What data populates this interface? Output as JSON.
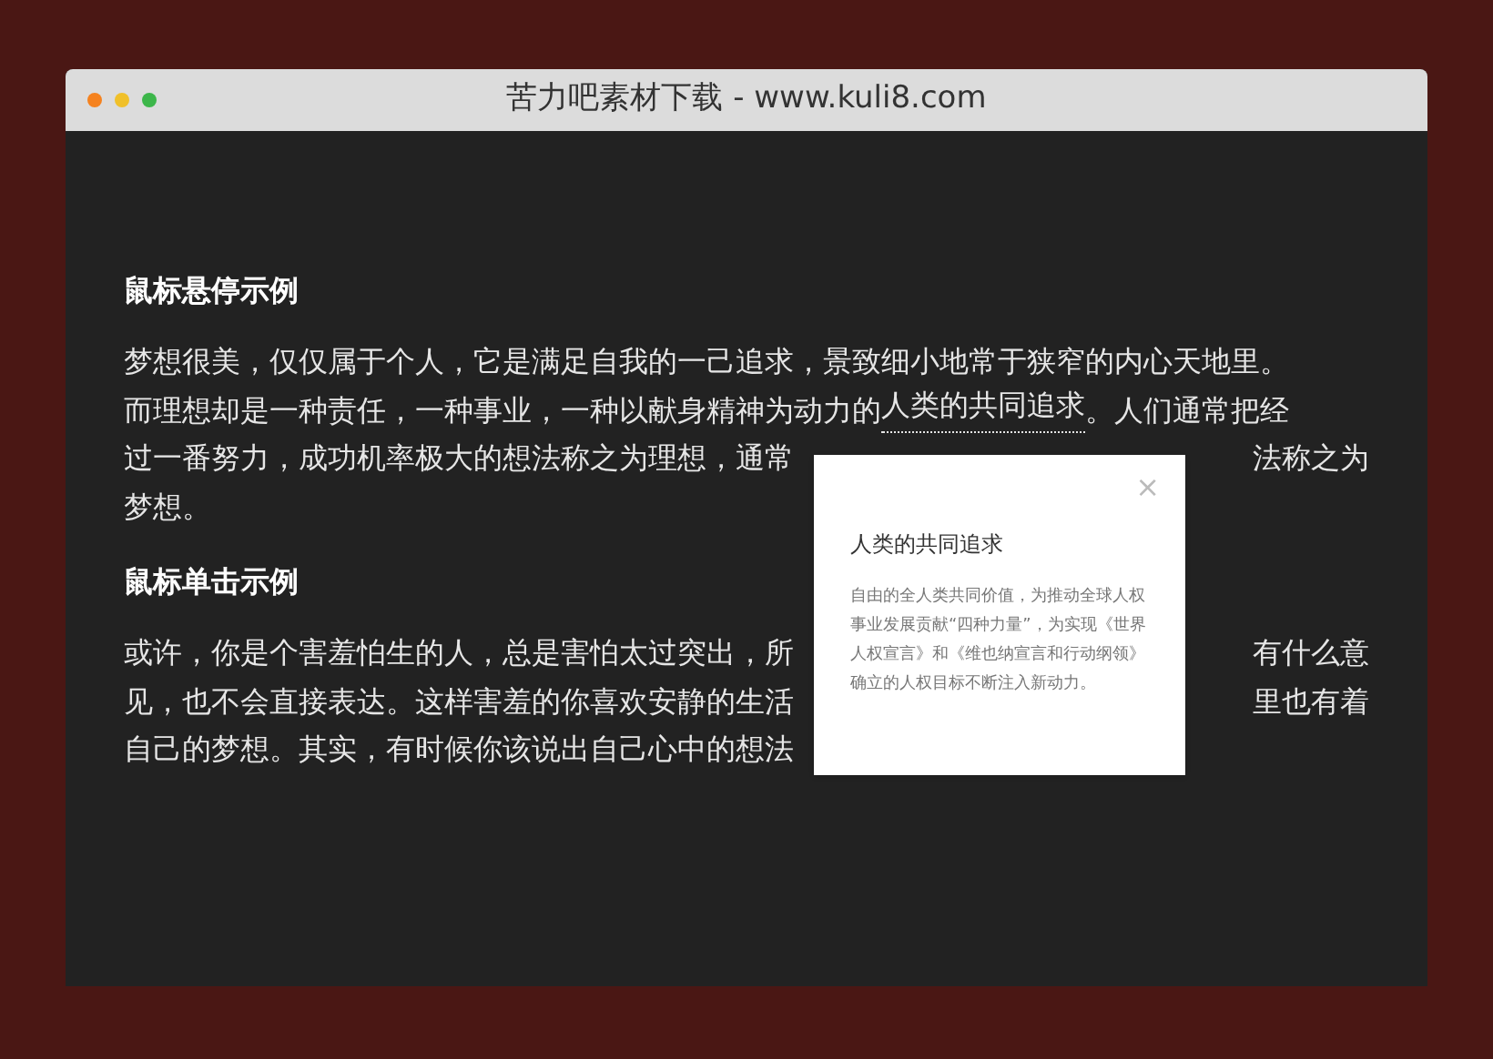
{
  "window": {
    "title": "苦力吧素材下载 - www.kuli8.com"
  },
  "sections": [
    {
      "heading": "鼠标悬停示例",
      "lines": [
        {
          "segments": [
            {
              "text": "梦想很美，仅仅属于个人，它是满足自我的一己追求，景致细小地常于狭窄的内心天地里。",
              "kind": "plain"
            }
          ]
        },
        {
          "segments": [
            {
              "text": "而理想却是一种责任，一种事业，一种以献身精神为动力的",
              "kind": "plain"
            },
            {
              "text": "人类的共同追求",
              "kind": "link"
            },
            {
              "text": "。人们通常把经",
              "kind": "plain"
            }
          ]
        },
        {
          "segments": [
            {
              "text": "过一番努力，成功机率极大的想法称之为理想，通常",
              "kind": "plain"
            }
          ],
          "right": "法称之为"
        },
        {
          "segments": [
            {
              "text": "梦想。",
              "kind": "plain"
            }
          ]
        }
      ]
    },
    {
      "heading": "鼠标单击示例",
      "lines": [
        {
          "segments": [
            {
              "text": "或许，你是个害羞怕生的人，总是害怕太过突出，所",
              "kind": "plain"
            }
          ],
          "right": "有什么意"
        },
        {
          "segments": [
            {
              "text": "见，也不会直接表达。这样害羞的你喜欢安静的生活",
              "kind": "plain"
            }
          ],
          "right": "里也有着"
        },
        {
          "segments": [
            {
              "text": "自己的梦想。其实，有时候你该说出自己心中的想法",
              "kind": "plain"
            }
          ]
        }
      ]
    }
  ],
  "popover": {
    "title": "人类的共同追求",
    "body": "自由的全人类共同价值，为推动全球人权事业发展贡献“四种力量”，为实现《世界人权宣言》和《维也纳宣言和行动纲领》确立的人权目标不断注入新动力。",
    "close": "×"
  }
}
